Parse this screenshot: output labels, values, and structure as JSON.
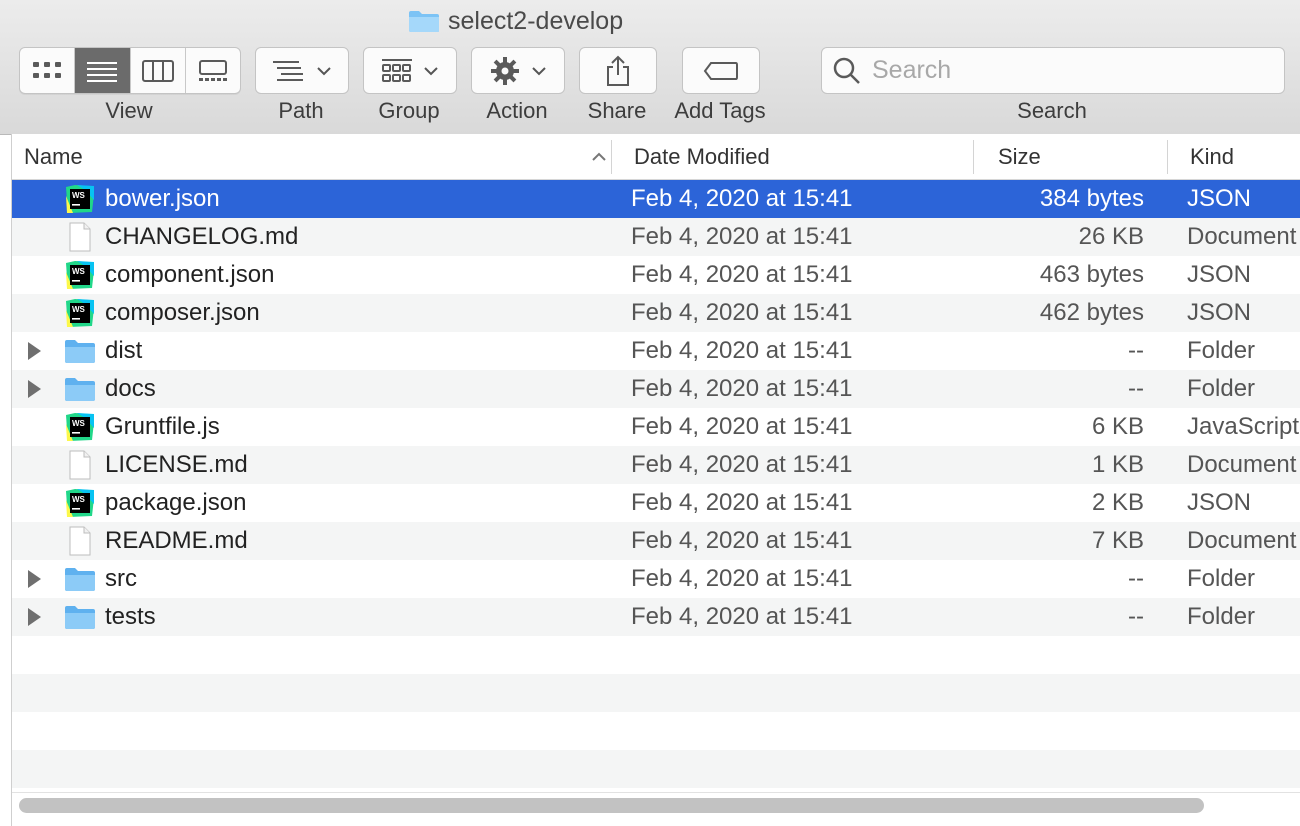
{
  "window": {
    "title": "select2-develop"
  },
  "toolbar": {
    "view_label": "View",
    "path_label": "Path",
    "group_label": "Group",
    "action_label": "Action",
    "share_label": "Share",
    "add_tags_label": "Add Tags",
    "search_label": "Search",
    "search_placeholder": "Search",
    "view_modes": [
      "icon-view-icon",
      "list-view-icon",
      "column-view-icon",
      "gallery-view-icon"
    ],
    "active_view": "list"
  },
  "columns": {
    "name": "Name",
    "date": "Date Modified",
    "size": "Size",
    "kind": "Kind"
  },
  "rows": [
    {
      "name": "bower.json",
      "date": "Feb 4, 2020 at 15:41",
      "size": "384 bytes",
      "kind": "JSON",
      "icon": "webstorm-file-icon",
      "selected": true
    },
    {
      "name": "CHANGELOG.md",
      "date": "Feb 4, 2020 at 15:41",
      "size": "26 KB",
      "kind": "Document",
      "icon": "document-icon"
    },
    {
      "name": "component.json",
      "date": "Feb 4, 2020 at 15:41",
      "size": "463 bytes",
      "kind": "JSON",
      "icon": "webstorm-file-icon"
    },
    {
      "name": "composer.json",
      "date": "Feb 4, 2020 at 15:41",
      "size": "462 bytes",
      "kind": "JSON",
      "icon": "webstorm-file-icon"
    },
    {
      "name": "dist",
      "date": "Feb 4, 2020 at 15:41",
      "size": "--",
      "kind": "Folder",
      "icon": "folder-icon",
      "folder": true
    },
    {
      "name": "docs",
      "date": "Feb 4, 2020 at 15:41",
      "size": "--",
      "kind": "Folder",
      "icon": "folder-icon",
      "folder": true
    },
    {
      "name": "Gruntfile.js",
      "date": "Feb 4, 2020 at 15:41",
      "size": "6 KB",
      "kind": "JavaScript",
      "icon": "webstorm-file-icon"
    },
    {
      "name": "LICENSE.md",
      "date": "Feb 4, 2020 at 15:41",
      "size": "1 KB",
      "kind": "Document",
      "icon": "document-icon"
    },
    {
      "name": "package.json",
      "date": "Feb 4, 2020 at 15:41",
      "size": "2 KB",
      "kind": "JSON",
      "icon": "webstorm-file-icon"
    },
    {
      "name": "README.md",
      "date": "Feb 4, 2020 at 15:41",
      "size": "7 KB",
      "kind": "Document",
      "icon": "document-icon"
    },
    {
      "name": "src",
      "date": "Feb 4, 2020 at 15:41",
      "size": "--",
      "kind": "Folder",
      "icon": "folder-icon",
      "folder": true
    },
    {
      "name": "tests",
      "date": "Feb 4, 2020 at 15:41",
      "size": "--",
      "kind": "Folder",
      "icon": "folder-icon",
      "folder": true
    }
  ],
  "colors": {
    "selection": "#2c64d8",
    "folder": "#6cb8f1",
    "alt_row": "#f4f5f5"
  }
}
